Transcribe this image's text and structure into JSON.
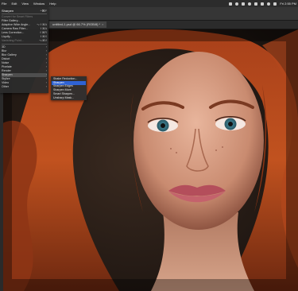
{
  "menubar": {
    "items": [
      "File",
      "Edit",
      "View",
      "Window",
      "Help"
    ],
    "clock": "Fri 2:55 PM"
  },
  "document_tab": {
    "label": "untitled-1.psd @ 66.7% (RGB/8) *",
    "close": "×"
  },
  "filter_menu": {
    "title": "Sharpen",
    "title_shortcut": "^⌘F",
    "items": [
      {
        "label": "Convert for Smart Filters",
        "shortcut": "",
        "submenu": false,
        "dim": true
      },
      {
        "label": "Filter Gallery...",
        "shortcut": "",
        "submenu": false,
        "dim": false
      },
      {
        "label": "Adaptive Wide Angle...",
        "shortcut": "⌥⇧⌘A",
        "submenu": false,
        "dim": false
      },
      {
        "label": "Camera Raw Filter...",
        "shortcut": "⇧⌘A",
        "submenu": false,
        "dim": false
      },
      {
        "label": "Lens Correction...",
        "shortcut": "⇧⌘R",
        "submenu": false,
        "dim": false
      },
      {
        "label": "Liquify...",
        "shortcut": "⇧⌘X",
        "submenu": false,
        "dim": false
      },
      {
        "label": "Vanishing Point...",
        "shortcut": "⌥⌘V",
        "submenu": false,
        "dim": true
      },
      {
        "label": "3D",
        "shortcut": "",
        "submenu": true,
        "dim": false
      },
      {
        "label": "Blur",
        "shortcut": "",
        "submenu": true,
        "dim": false
      },
      {
        "label": "Blur Gallery",
        "shortcut": "",
        "submenu": true,
        "dim": false
      },
      {
        "label": "Distort",
        "shortcut": "",
        "submenu": true,
        "dim": false
      },
      {
        "label": "Noise",
        "shortcut": "",
        "submenu": true,
        "dim": false
      },
      {
        "label": "Pixelate",
        "shortcut": "",
        "submenu": true,
        "dim": false
      },
      {
        "label": "Render",
        "shortcut": "",
        "submenu": true,
        "dim": false
      },
      {
        "label": "Sharpen",
        "shortcut": "",
        "submenu": true,
        "dim": false,
        "active": true
      },
      {
        "label": "Stylize",
        "shortcut": "",
        "submenu": true,
        "dim": false
      },
      {
        "label": "Video",
        "shortcut": "",
        "submenu": true,
        "dim": false
      },
      {
        "label": "Other",
        "shortcut": "",
        "submenu": true,
        "dim": false
      }
    ]
  },
  "sharpen_submenu": {
    "items": [
      {
        "label": "Shake Reduction...",
        "highlight": false
      },
      {
        "label": "Sharpen",
        "highlight": true
      },
      {
        "label": "Sharpen Edges",
        "highlight": false
      },
      {
        "label": "Sharpen More",
        "highlight": false
      },
      {
        "label": "Smart Sharpen...",
        "highlight": false
      },
      {
        "label": "Unsharp Mask...",
        "highlight": false
      }
    ]
  },
  "colors": {
    "menu_highlight": "#2f62d3",
    "hair": "#b5461c"
  }
}
